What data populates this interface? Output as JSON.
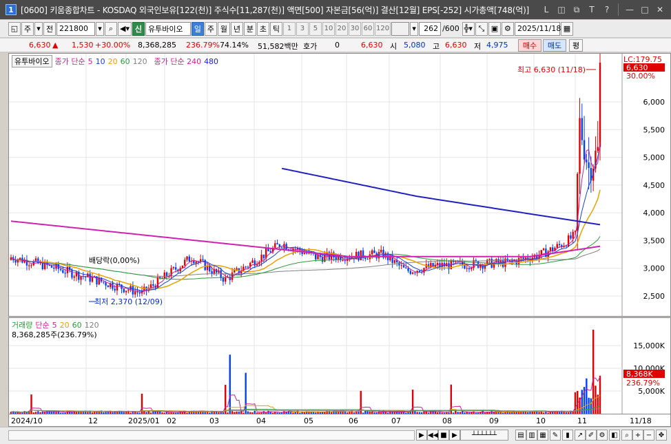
{
  "window": {
    "number": "1",
    "title": "[0600] 키움종합차트 - KOSDAQ 외국인보유[122(천)] 주식수[11,287(천)] 액면[500] 자본금[56(억)] 결산[12월] EPS[-252] 시가총액[748(억)]",
    "buttons": [
      "L",
      "◫",
      "⧉",
      "T",
      "?",
      "—",
      "□",
      "✕"
    ]
  },
  "toolbar": {
    "period_type": "주",
    "prev_label": "전",
    "code": "221800",
    "sin_label": "신",
    "stock_name": "유투바이오",
    "tabs": [
      "일",
      "주",
      "월",
      "년",
      "분",
      "초",
      "틱"
    ],
    "active_tab": "일",
    "periods": [
      "1",
      "3",
      "5",
      "10",
      "20",
      "30",
      "60",
      "120"
    ],
    "count": "262",
    "count_total": "/600",
    "date": "2025/11/18"
  },
  "quote": {
    "price": "6,630",
    "change": "1,530",
    "change_pct": "+30.00%",
    "volume": "8,368,285",
    "volume_pct": "236.79%",
    "ratio": "74.14%",
    "amount": "51,582백만",
    "hoga_label": "호가",
    "hoga_value": "0",
    "hoga_price": "6,630",
    "open_label": "시",
    "open": "5,080",
    "high_label": "고",
    "high": "6,630",
    "low_label": "저",
    "low": "4,975",
    "buy_label": "매수",
    "sell_label": "매도",
    "eval_label": "평"
  },
  "price_legend": {
    "name": "유투바이오",
    "ma_label": "종가 단순",
    "ma_periods": [
      "5",
      "10",
      "20",
      "60",
      "120"
    ],
    "ma240_label": "종가 단순 240",
    "ma480": "480",
    "colors": {
      "p5": "#cc2090",
      "p10": "#1540d0",
      "p20": "#e8a000",
      "p60": "#2a9a3a",
      "p120": "#808080",
      "p240": "#d020b0",
      "p480": "#2020c0"
    }
  },
  "annotations": {
    "high": "최고 6,630 (11/18)",
    "low": "최저 2,370 (12/09)",
    "dividend": "배당락(0,00%)",
    "lc": "LC:179.75",
    "last_price_tag": "6,630",
    "last_pct_tag": "30.00%"
  },
  "price_axis": [
    "6,000",
    "5,500",
    "5,000",
    "4,500",
    "4,000",
    "3,500",
    "3,000",
    "2,500"
  ],
  "volume_legend": {
    "label": "거래량",
    "ma_label": "단순",
    "periods": [
      "5",
      "20",
      "60",
      "120"
    ],
    "value_line": "8,368,285주(236.79%)"
  },
  "volume_axis": [
    "15,000K",
    "10,000K",
    "5,000K"
  ],
  "volume_tags": {
    "value": "8,368K",
    "pct": "236.79%"
  },
  "x_axis": [
    "2024/10",
    "12",
    "2025/01",
    "02",
    "03",
    "04",
    "05",
    "06",
    "07",
    "08",
    "09",
    "10",
    "11",
    "11/18"
  ]
}
